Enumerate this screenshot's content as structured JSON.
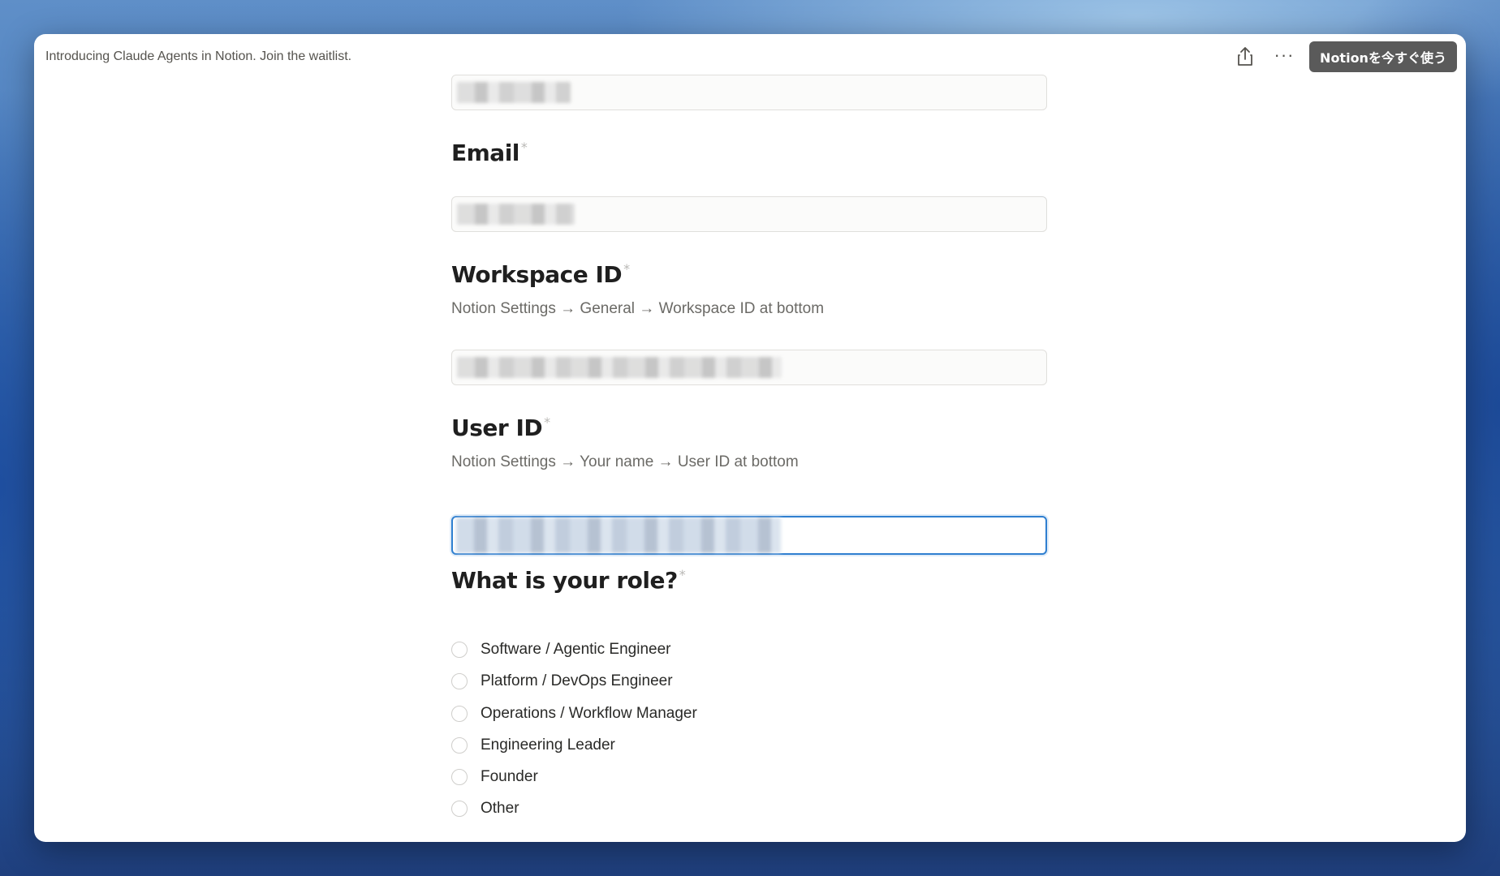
{
  "banner": {
    "text": "Introducing Claude Agents in Notion. Join the waitlist."
  },
  "toolbar": {
    "share_icon": "share-icon",
    "more_icon": "ellipsis-icon",
    "more_glyph": "···",
    "cta_label": "Notionを今すぐ使う"
  },
  "form": {
    "name_field": {
      "value": ""
    },
    "email": {
      "label": "Email",
      "required_mark": "*",
      "value": ""
    },
    "workspace_id": {
      "label": "Workspace ID",
      "required_mark": "*",
      "hint": "Notion Settings → General → Workspace ID at bottom",
      "value": ""
    },
    "user_id": {
      "label": "User ID",
      "required_mark": "*",
      "hint": "Notion Settings → Your name → User ID at bottom",
      "value": "",
      "focused": true
    },
    "role": {
      "label": "What is your role?",
      "required_mark": "*",
      "options": [
        "Software / Agentic Engineer",
        "Platform / DevOps Engineer",
        "Operations / Workflow Manager",
        "Engineering Leader",
        "Founder",
        "Other"
      ]
    }
  },
  "colors": {
    "cta_bg": "#5a5a5a",
    "focus_border": "#2f7fd0",
    "label": "#1f1f1f",
    "hint": "#6b6a66"
  }
}
